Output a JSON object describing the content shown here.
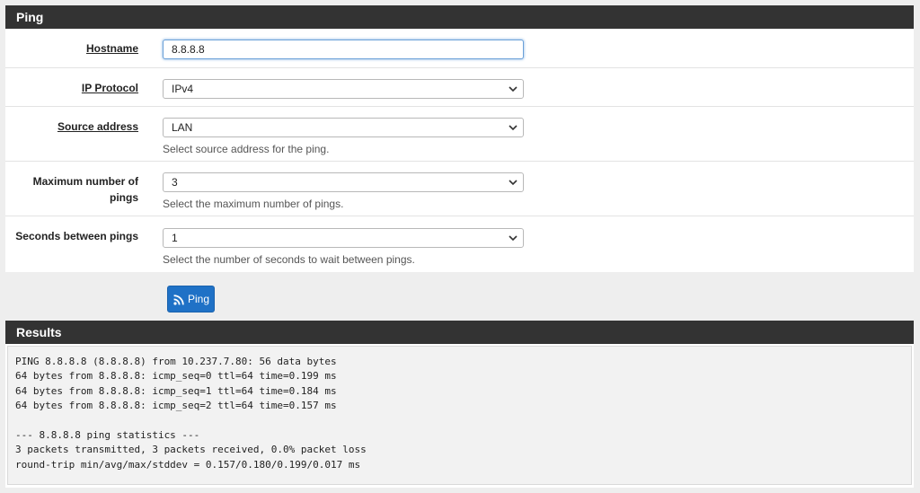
{
  "ping_panel": {
    "title": "Ping",
    "hostname": {
      "label": "Hostname",
      "value": "8.8.8.8"
    },
    "ip_protocol": {
      "label": "IP Protocol",
      "value": "IPv4"
    },
    "source_address": {
      "label": "Source address",
      "value": "LAN",
      "help": "Select source address for the ping."
    },
    "max_pings": {
      "label_line1": "Maximum number of",
      "label_line2": "pings",
      "value": "3",
      "help": "Select the maximum number of pings."
    },
    "seconds_between": {
      "label": "Seconds between pings",
      "value": "1",
      "help": "Select the number of seconds to wait between pings."
    },
    "ping_button": {
      "label": "Ping",
      "icon": "rss-icon"
    }
  },
  "results_panel": {
    "title": "Results",
    "lines": [
      "PING 8.8.8.8 (8.8.8.8) from 10.237.7.80: 56 data bytes",
      "64 bytes from 8.8.8.8: icmp_seq=0 ttl=64 time=0.199 ms",
      "64 bytes from 8.8.8.8: icmp_seq=1 ttl=64 time=0.184 ms",
      "64 bytes from 8.8.8.8: icmp_seq=2 ttl=64 time=0.157 ms",
      "",
      "--- 8.8.8.8 ping statistics ---",
      "3 packets transmitted, 3 packets received, 0.0% packet loss",
      "round-trip min/avg/max/stddev = 0.157/0.180/0.199/0.017 ms"
    ]
  },
  "colors": {
    "header_bg": "#333333",
    "button_bg": "#1f71c6",
    "page_bg": "#eeeeee"
  }
}
